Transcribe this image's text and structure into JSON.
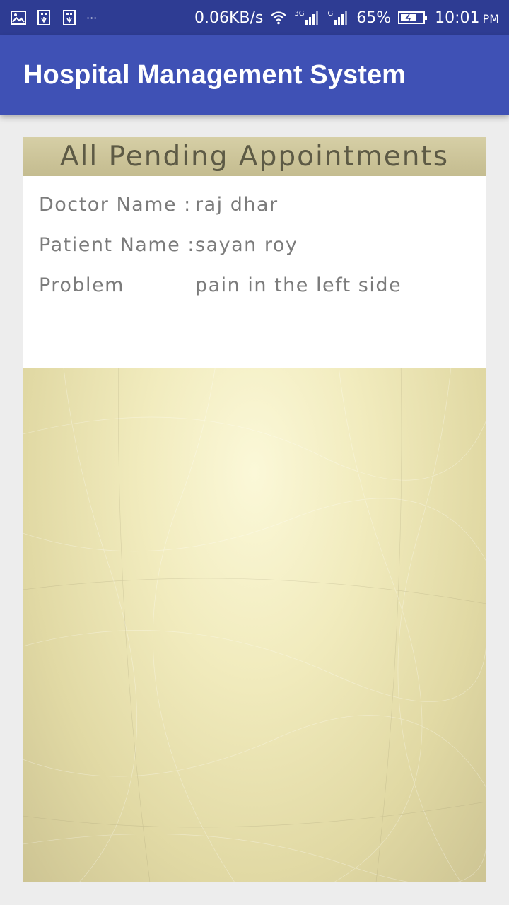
{
  "status_bar": {
    "net_speed": "0.06KB/s",
    "network_1": "3G",
    "network_2": "G",
    "battery": "65%",
    "time": "10:01",
    "ampm": "PM",
    "overflow": "···"
  },
  "app_bar": {
    "title": "Hospital Management System"
  },
  "panel": {
    "heading": "All Pending Appointments",
    "appointment": {
      "doctor_label": "Doctor Name :",
      "doctor_value": "raj dhar",
      "patient_label": "Patient Name :",
      "patient_value": "sayan roy",
      "problem_label": "Problem",
      "problem_value": "pain in the left side"
    }
  },
  "colors": {
    "status_bar": "#2e3c93",
    "app_bar": "#3f51b5",
    "background": "#ededed"
  }
}
